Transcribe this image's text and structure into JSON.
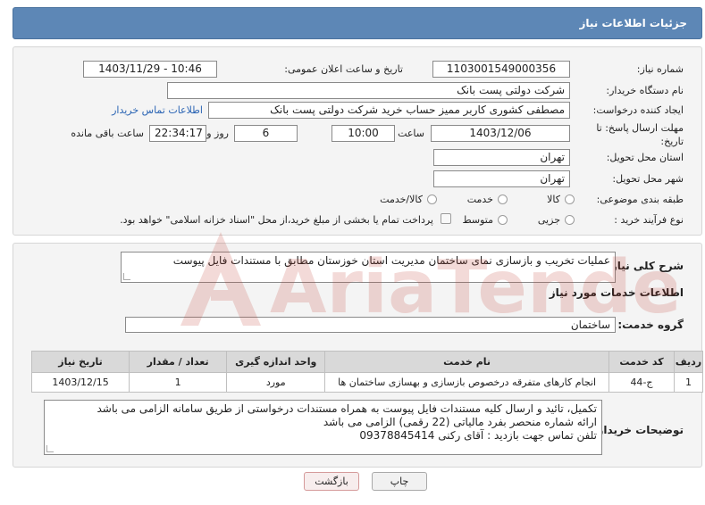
{
  "header": {
    "title": "جزئیات اطلاعات نیاز"
  },
  "form": {
    "need_number_label": "شماره نیاز:",
    "need_number": "1103001549000356",
    "announce_label": "تاریخ و ساعت اعلان عمومی:",
    "announce_value": "1403/11/29 - 10:46",
    "buyer_org_label": "نام دستگاه خریدار:",
    "buyer_org": "شرکت دولتی پست بانک",
    "requester_label": "ایجاد کننده درخواست:",
    "requester": "مصطفی کشوری کاربر ممیز حساب خرید شرکت دولتی پست بانک",
    "contact_link": "اطلاعات تماس خریدار",
    "deadline_label_1": "مهلت ارسال پاسخ: تا",
    "deadline_label_2": "تاریخ:",
    "deadline_date": "1403/12/06",
    "time_label": "ساعت",
    "deadline_time": "10:00",
    "days_value": "6",
    "days_label": "روز و",
    "remaining_time": "22:34:17",
    "remaining_label": "ساعت باقی مانده",
    "province_label": "استان محل تحویل:",
    "province": "تهران",
    "city_label": "شهر محل تحویل:",
    "city": "تهران",
    "category_label": "طبقه بندی موضوعی:",
    "category_options": [
      "کالا",
      "خدمت",
      "کالا/خدمت"
    ],
    "process_label": "نوع فرآیند خرید :",
    "process_options": [
      "جزیی",
      "متوسط"
    ],
    "payment_note": "پرداخت تمام یا بخشی از مبلغ خرید،از محل \"اسناد خزانه اسلامی\" خواهد بود."
  },
  "details": {
    "summary_label": "شرح کلی نیاز:",
    "summary": "عملیات تخریب و بازسازی نمای ساختمان مدیریت استان خوزستان مطابق با مستندات فایل پیوست",
    "services_heading": "اطلاعات خدمات مورد نیاز",
    "group_label": "گروه خدمت:",
    "group_value": "ساختمان",
    "table": {
      "headers": [
        "ردیف",
        "کد خدمت",
        "نام خدمت",
        "واحد اندازه گیری",
        "تعداد / مقدار",
        "تاریخ نیاز"
      ],
      "rows": [
        [
          "1",
          "ج-44",
          "انجام کارهای متفرقه درخصوص بازسازی و بهسازی ساختمان ها",
          "مورد",
          "1",
          "1403/12/15"
        ]
      ]
    },
    "buyer_notes_label": "توضیحات خریدار:",
    "buyer_notes": [
      "تکمیل، تائید و ارسال کلیه مستندات فایل پیوست به همراه مستندات درخواستی از طریق سامانه الزامی می باشد",
      "ارائه شماره منحصر بفرد مالیاتی (22 رقمی) الزامی می باشد",
      "تلفن تماس جهت بازدید : آقای رکنی 09378845414"
    ]
  },
  "buttons": {
    "print": "چاپ",
    "back": "بازگشت"
  },
  "watermark_text": "AriaTender.neT",
  "colors": {
    "header": "#5d87b6",
    "link": "#2a64b4",
    "watermark": "#c0392b"
  }
}
